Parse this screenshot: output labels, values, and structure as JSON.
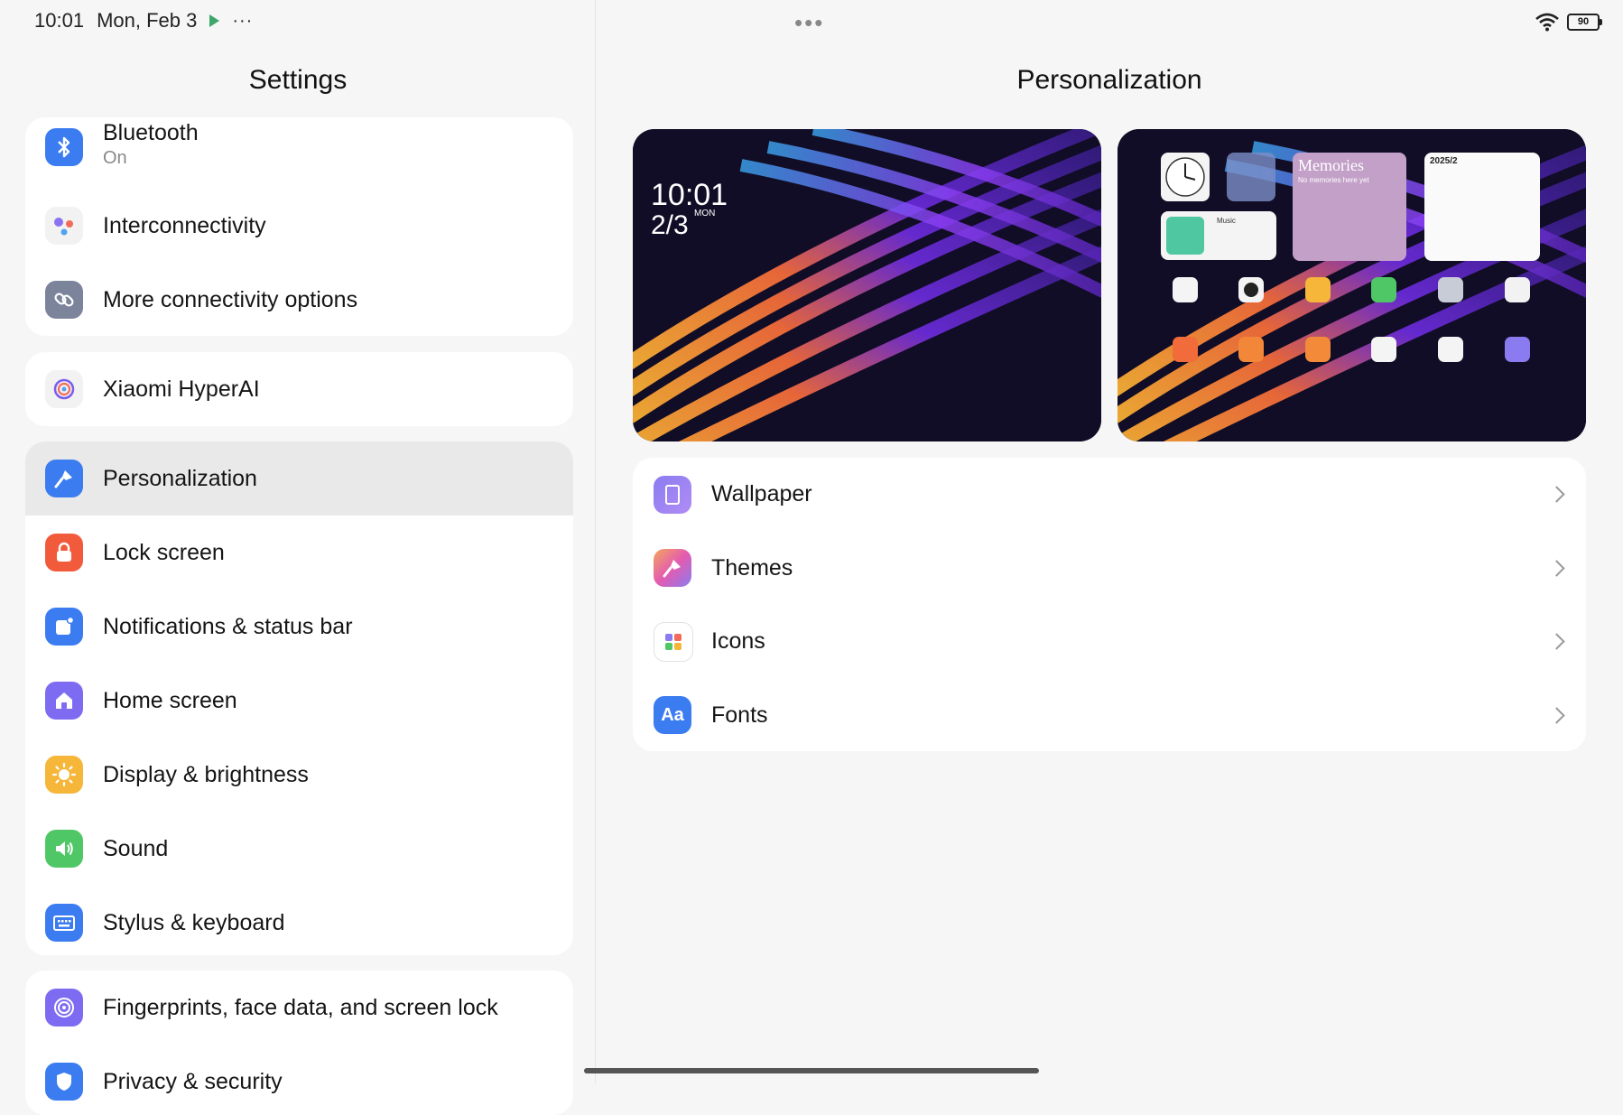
{
  "status_bar": {
    "time": "10:01",
    "date": "Mon, Feb 3",
    "more": "···",
    "center_handle": "•••",
    "battery": "90"
  },
  "left": {
    "title": "Settings",
    "groups": [
      {
        "items": [
          {
            "label": "Bluetooth",
            "sublabel": "On",
            "icon": "bluetooth-icon",
            "color": "#3b7cf0"
          },
          {
            "label": "Interconnectivity",
            "icon": "interconnectivity-icon",
            "color": "#f2f2f2"
          },
          {
            "label": "More connectivity options",
            "icon": "link-icon",
            "color": "#7b849b"
          }
        ]
      },
      {
        "items": [
          {
            "label": "Xiaomi HyperAI",
            "icon": "hyperai-icon",
            "color": "#f2f2f2"
          }
        ]
      },
      {
        "items": [
          {
            "label": "Personalization",
            "icon": "paintbrush-icon",
            "color": "#3b7cf0",
            "active": true
          },
          {
            "label": "Lock screen",
            "icon": "lock-icon",
            "color": "#f25a3c"
          },
          {
            "label": "Notifications & status bar",
            "icon": "notification-icon",
            "color": "#3b7cf0"
          },
          {
            "label": "Home screen",
            "icon": "home-icon",
            "color": "#7d6cf2"
          },
          {
            "label": "Display & brightness",
            "icon": "sun-icon",
            "color": "#f5b63a"
          },
          {
            "label": "Sound",
            "icon": "speaker-icon",
            "color": "#4fc766"
          },
          {
            "label": "Stylus & keyboard",
            "icon": "keyboard-icon",
            "color": "#3b7cf0"
          }
        ]
      },
      {
        "items": [
          {
            "label": "Fingerprints, face data, and screen lock",
            "icon": "fingerprint-icon",
            "color": "#7d6cf2"
          },
          {
            "label": "Privacy & security",
            "icon": "shield-icon",
            "color": "#3b7cf0"
          }
        ]
      }
    ]
  },
  "right": {
    "title": "Personalization",
    "lock_preview": {
      "time": "10:01",
      "date": "2/3",
      "weekday": "MON"
    },
    "home_preview": {
      "memories_title": "Memories",
      "memories_sub": "No memories here yet",
      "calendar": "2025/2",
      "music": "Music"
    },
    "options": [
      {
        "label": "Wallpaper",
        "icon": "wallpaper-icon",
        "color": "#8a7cf0"
      },
      {
        "label": "Themes",
        "icon": "themes-icon",
        "color": "#f07a5a"
      },
      {
        "label": "Icons",
        "icon": "icons-grid-icon",
        "color": "#ffffff"
      },
      {
        "label": "Fonts",
        "icon": "fonts-icon",
        "color": "#3b7cf0",
        "glyph": "Aa"
      }
    ]
  }
}
